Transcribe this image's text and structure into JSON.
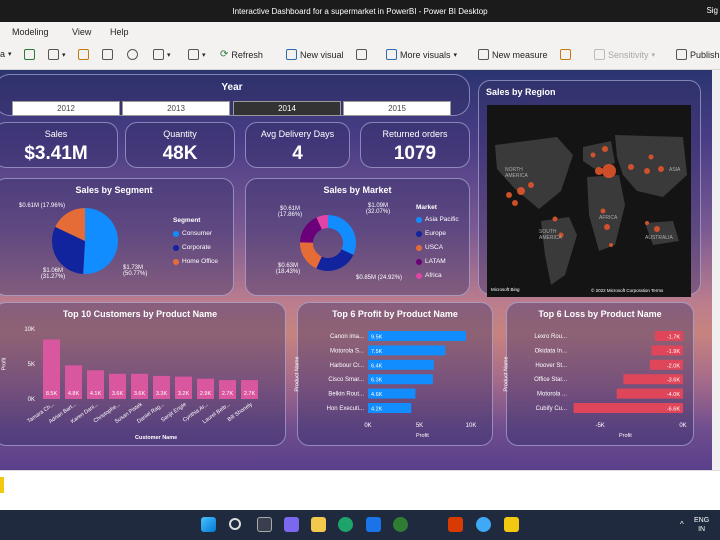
{
  "window": {
    "title": "Interactive Dashboard for a supermarket in PowerBI - Power BI Desktop",
    "sign_in": "Sig"
  },
  "menu": {
    "items": [
      "Modeling",
      "View",
      "Help"
    ]
  },
  "ribbon": {
    "refresh": "Refresh",
    "new_visual": "New visual",
    "more_visuals": "More visuals",
    "new_measure": "New measure",
    "sensitivity": "Sensitivity",
    "publish": "Publish"
  },
  "year_slicer": {
    "title": "Year",
    "options": [
      "2012",
      "2013",
      "2014",
      "2015"
    ],
    "selected": "2014"
  },
  "kpis": [
    {
      "label": "Sales",
      "value": "$3.41M"
    },
    {
      "label": "Quantity",
      "value": "48K"
    },
    {
      "label": "Avg Delivery Days",
      "value": "4"
    },
    {
      "label": "Returned orders",
      "value": "1079"
    }
  ],
  "sales_by_region": {
    "title": "Sales by Region",
    "labels": [
      "NORTH AMERICA",
      "ASIA",
      "AFRICA",
      "SOUTH AMERICA",
      "AUSTRALIA"
    ],
    "attribution_left": "Microsoft Bing",
    "attribution_right": "© 2022 Microsoft Corporation Terms"
  },
  "chart_data": [
    {
      "type": "pie",
      "title": "Sales by Segment",
      "legend_title": "Segment",
      "categories": [
        "Consumer",
        "Corporate",
        "Home Office"
      ],
      "values": [
        1.73,
        1.06,
        0.61
      ],
      "data_labels": [
        "$1.73M (50.77%)",
        "$1.06M (31.27%)",
        "$0.61M (17.96%)"
      ],
      "colors": [
        "#118dff",
        "#12239e",
        "#e66c37"
      ]
    },
    {
      "type": "pie",
      "title": "Sales by Market",
      "legend_title": "Market",
      "categories": [
        "Asia Pacific",
        "Europe",
        "USCA",
        "LATAM",
        "Africa"
      ],
      "values": [
        1.09,
        0.85,
        0.63,
        0.61,
        0.23
      ],
      "data_labels": [
        "$1.09M (32.07%)",
        "$0.85M (24.92%)",
        "$0.63M (18.43%)",
        "$0.61M (17.86%)",
        ""
      ],
      "colors": [
        "#118dff",
        "#12239e",
        "#e66c37",
        "#6b007b",
        "#e044a7"
      ]
    },
    {
      "type": "bar",
      "title": "Top 10 Customers by Product Name",
      "xlabel": "Customer Name",
      "ylabel": "Profit",
      "categories": [
        "Tamara Ch...",
        "Adrian Bart...",
        "Karen Dani...",
        "Christophe...",
        "Susan Pistek",
        "Daniel Rag...",
        "Sanjit Engle",
        "Cynthia Ar...",
        "Laurel Beltr...",
        "Bill Shonely"
      ],
      "values": [
        8.5,
        4.8,
        4.1,
        3.6,
        3.6,
        3.3,
        3.2,
        2.9,
        2.7,
        2.7
      ],
      "data_labels": [
        "8.5K",
        "4.8K",
        "4.1K",
        "3.6K",
        "3.6K",
        "3.3K",
        "3.2K",
        "2.9K",
        "2.7K",
        "2.7K"
      ],
      "yticks": [
        "0K",
        "5K",
        "10K"
      ],
      "ylim": [
        0,
        10
      ],
      "color": "#d9579f"
    },
    {
      "type": "bar",
      "orientation": "horizontal",
      "title": "Top 6 Profit by Product Name",
      "xlabel": "Profit",
      "ylabel": "Product Name",
      "categories": [
        "Canon ima...",
        "Motorola S...",
        "Harbour Cr...",
        "Cisco Smar...",
        "Belkin Rout...",
        "Hon Executi..."
      ],
      "values": [
        9.5,
        7.5,
        6.4,
        6.3,
        4.6,
        4.2
      ],
      "data_labels": [
        "9.5K",
        "7.5K",
        "6.4K",
        "6.3K",
        "4.6K",
        "4.2K"
      ],
      "xticks": [
        "0K",
        "5K",
        "10K"
      ],
      "xlim": [
        0,
        10
      ],
      "color": "#118dff"
    },
    {
      "type": "bar",
      "orientation": "horizontal",
      "title": "Top 6 Loss by Product Name",
      "xlabel": "Profit",
      "ylabel": "Product Name",
      "categories": [
        "Lexro Rou...",
        "Okidata In...",
        "Hoover St...",
        "Office Star...",
        "Motorola ...",
        "Cubify Cu..."
      ],
      "values": [
        -1.7,
        -1.9,
        -2.0,
        -3.6,
        -4.0,
        -6.6
      ],
      "data_labels": [
        "-1.7K",
        "-1.9K",
        "-2.0K",
        "-3.6K",
        "-4.0K",
        "-6.6K"
      ],
      "xticks": [
        "-5K",
        "0K"
      ],
      "xlim": [
        -7,
        0
      ],
      "color": "#e0465a"
    }
  ],
  "taskbar": {
    "lang_top": "ENG",
    "lang_bottom": "IN"
  }
}
